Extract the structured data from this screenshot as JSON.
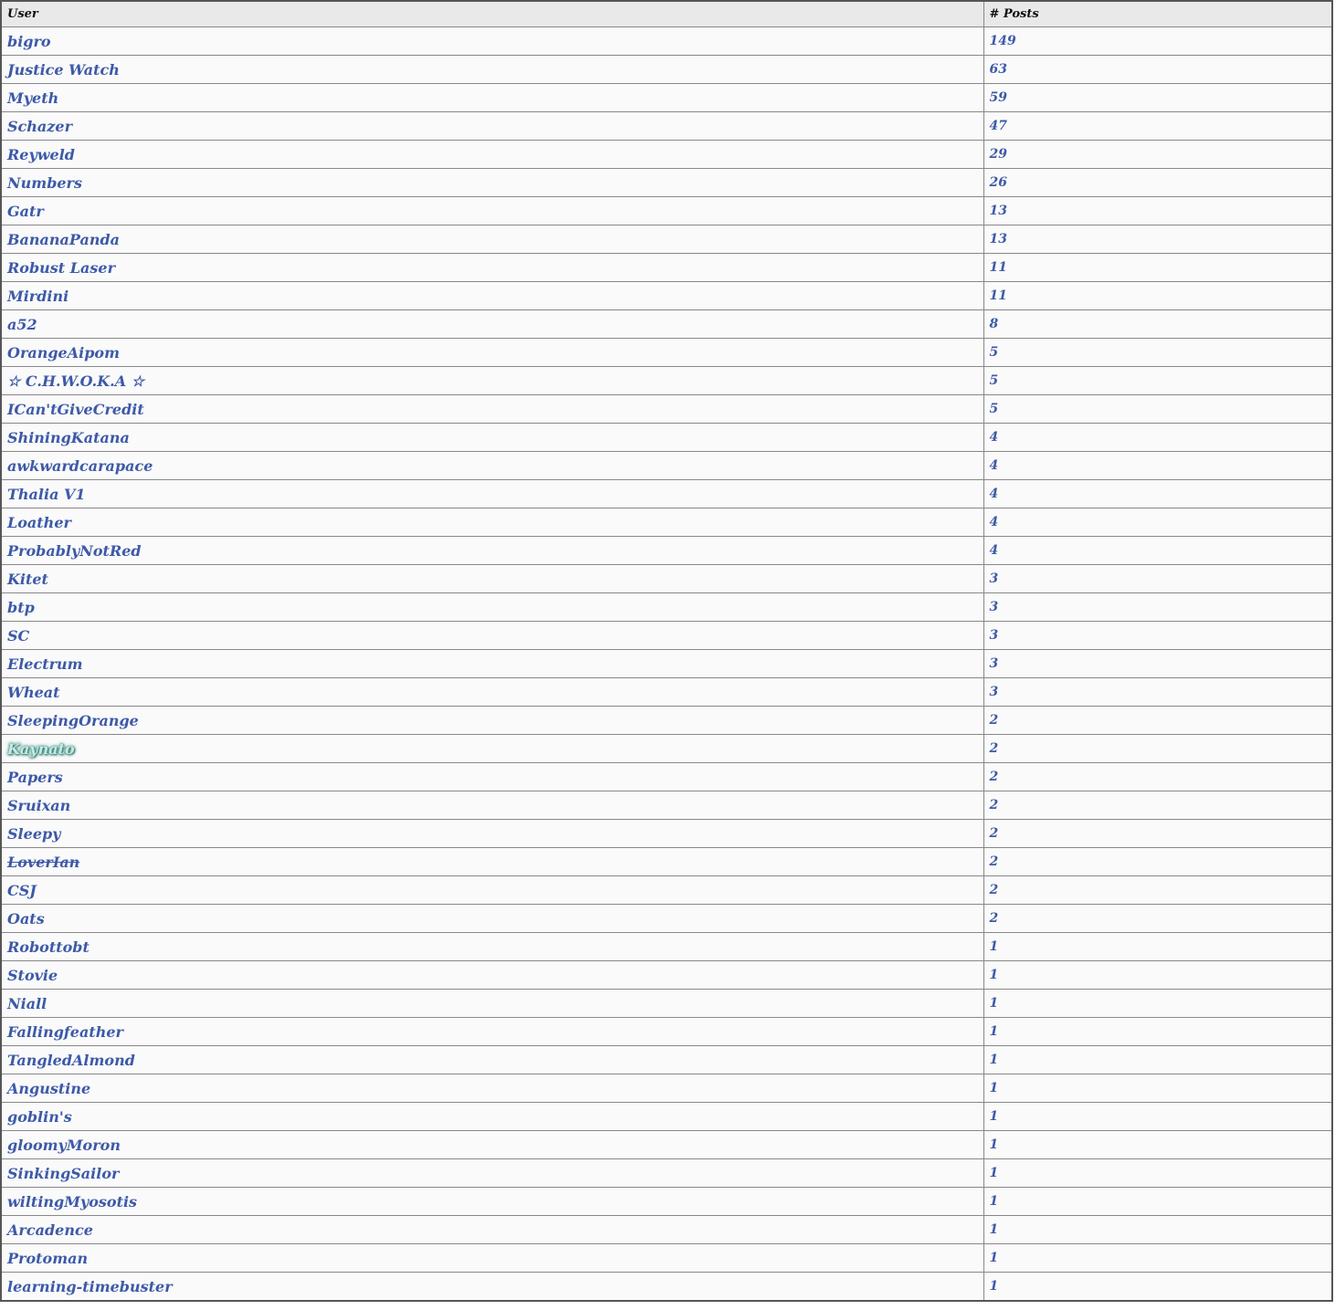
{
  "table": {
    "headers": {
      "user": "User",
      "posts": "# Posts"
    },
    "colors": {
      "link": "#3d5aa8",
      "header_bg": "#e9e9e9",
      "row_bg": "#fafafa",
      "border": "#888888",
      "glow": "#2e8a7c"
    },
    "rows": [
      {
        "user": "bigro",
        "posts": "149"
      },
      {
        "user": "Justice Watch",
        "posts": "63"
      },
      {
        "user": "Myeth",
        "posts": "59"
      },
      {
        "user": "Schazer",
        "posts": "47"
      },
      {
        "user": "Reyweld",
        "posts": "29"
      },
      {
        "user": "Numbers",
        "posts": "26"
      },
      {
        "user": "Gatr",
        "posts": "13"
      },
      {
        "user": "BananaPanda",
        "posts": "13"
      },
      {
        "user": "Robust Laser",
        "posts": "11"
      },
      {
        "user": "Mirdini",
        "posts": "11"
      },
      {
        "user": "a52",
        "posts": "8"
      },
      {
        "user": "OrangeAipom",
        "posts": "5"
      },
      {
        "user": "☆ C.H.W.O.K.A ☆",
        "posts": "5"
      },
      {
        "user": "ICan'tGiveCredit",
        "posts": "5"
      },
      {
        "user": "ShiningKatana",
        "posts": "4"
      },
      {
        "user": "awkwardcarapace",
        "posts": "4"
      },
      {
        "user": "Thalia V1",
        "posts": "4"
      },
      {
        "user": "Loather",
        "posts": "4"
      },
      {
        "user": "ProbablyNotRed",
        "posts": "4"
      },
      {
        "user": "Kitet",
        "posts": "3"
      },
      {
        "user": "btp",
        "posts": "3"
      },
      {
        "user": "SC",
        "posts": "3"
      },
      {
        "user": "Electrum",
        "posts": "3"
      },
      {
        "user": "Wheat",
        "posts": "3"
      },
      {
        "user": "SleepingOrange",
        "posts": "2"
      },
      {
        "user": "Kaynato",
        "posts": "2",
        "style": "glow"
      },
      {
        "user": "Papers",
        "posts": "2"
      },
      {
        "user": "Sruixan",
        "posts": "2"
      },
      {
        "user": "Sleepy",
        "posts": "2"
      },
      {
        "user": "LoverIan",
        "posts": "2",
        "style": "strike"
      },
      {
        "user": "CSJ",
        "posts": "2"
      },
      {
        "user": "Oats",
        "posts": "2"
      },
      {
        "user": "Robottobt",
        "posts": "1"
      },
      {
        "user": "Stovie",
        "posts": "1"
      },
      {
        "user": "Niall",
        "posts": "1"
      },
      {
        "user": "Fallingfeather",
        "posts": "1"
      },
      {
        "user": "TangledAlmond",
        "posts": "1"
      },
      {
        "user": "Angustine",
        "posts": "1"
      },
      {
        "user": "goblin's",
        "posts": "1"
      },
      {
        "user": "gloomyMoron",
        "posts": "1"
      },
      {
        "user": "SinkingSailor",
        "posts": "1"
      },
      {
        "user": "wiltingMyosotis",
        "posts": "1"
      },
      {
        "user": "Arcadence",
        "posts": "1"
      },
      {
        "user": "Protoman",
        "posts": "1"
      },
      {
        "user": "learning-timebuster",
        "posts": "1"
      }
    ]
  }
}
